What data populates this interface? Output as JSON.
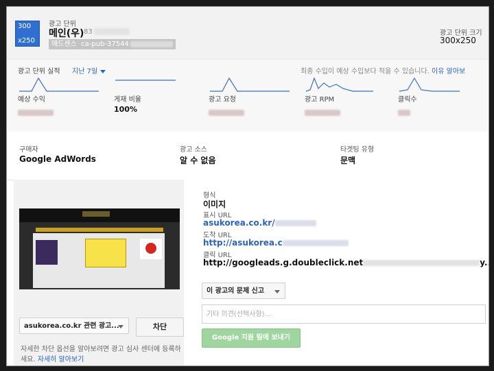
{
  "header": {
    "icon_line1": "300",
    "icon_line2": "x250",
    "ad_unit_label": "광고 단위",
    "ad_unit_name": "메인(우)",
    "ad_unit_id_prefix": "83",
    "product": "애드센스",
    "publisher_id": "ca-pub-37544",
    "size_label": "광고 단위 크기",
    "size_value": "300x250"
  },
  "performance": {
    "title": "광고 단위 실적",
    "period": "지난 7일",
    "note": "최종 수입이 예상 수입보다 적을 수 있습니다.",
    "note_link": "이유 알아보",
    "metrics": [
      {
        "label": "예상 수익",
        "value": null
      },
      {
        "label": "게재 비율",
        "value": "100%"
      },
      {
        "label": "광고 요청",
        "value": null
      },
      {
        "label": "광고 RPM",
        "value": null
      },
      {
        "label": "클릭수",
        "value": null
      }
    ]
  },
  "buyer": {
    "buyer_label": "구매자",
    "buyer_value": "Google AdWords",
    "source_label": "광고 소스",
    "source_value": "알 수 없음",
    "targeting_label": "타겟팅 유형",
    "targeting_value": "문맥"
  },
  "ad_detail": {
    "format_label": "형식",
    "format_value": "이미지",
    "display_url_label": "표시 URL",
    "display_url": "asukorea.co.kr/",
    "destination_label": "도착 URL",
    "destination_url": "http://asukorea.c",
    "click_label": "클릭 URL",
    "click_url": "http://googleads.g.doubleclick.net",
    "click_url_tail": "y..."
  },
  "actions": {
    "related_ads_dropdown": "asukorea.co.kr 관련 광고...",
    "block_button": "차단",
    "block_note": "자세한 차단 옵션을 알아보려면 광고 심사 센터에 등록하세요.",
    "block_note_link": "자세히 알아보기",
    "report_dropdown": "이 광고의 문제 신고",
    "comment_placeholder": "기타 의견(선택사항)...",
    "send_button": "Google 지원 팀에 보내기"
  },
  "colors": {
    "link": "#2a63c4",
    "icon_bg": "#2f6fd1",
    "send_button_bg": "#9fd69f"
  }
}
